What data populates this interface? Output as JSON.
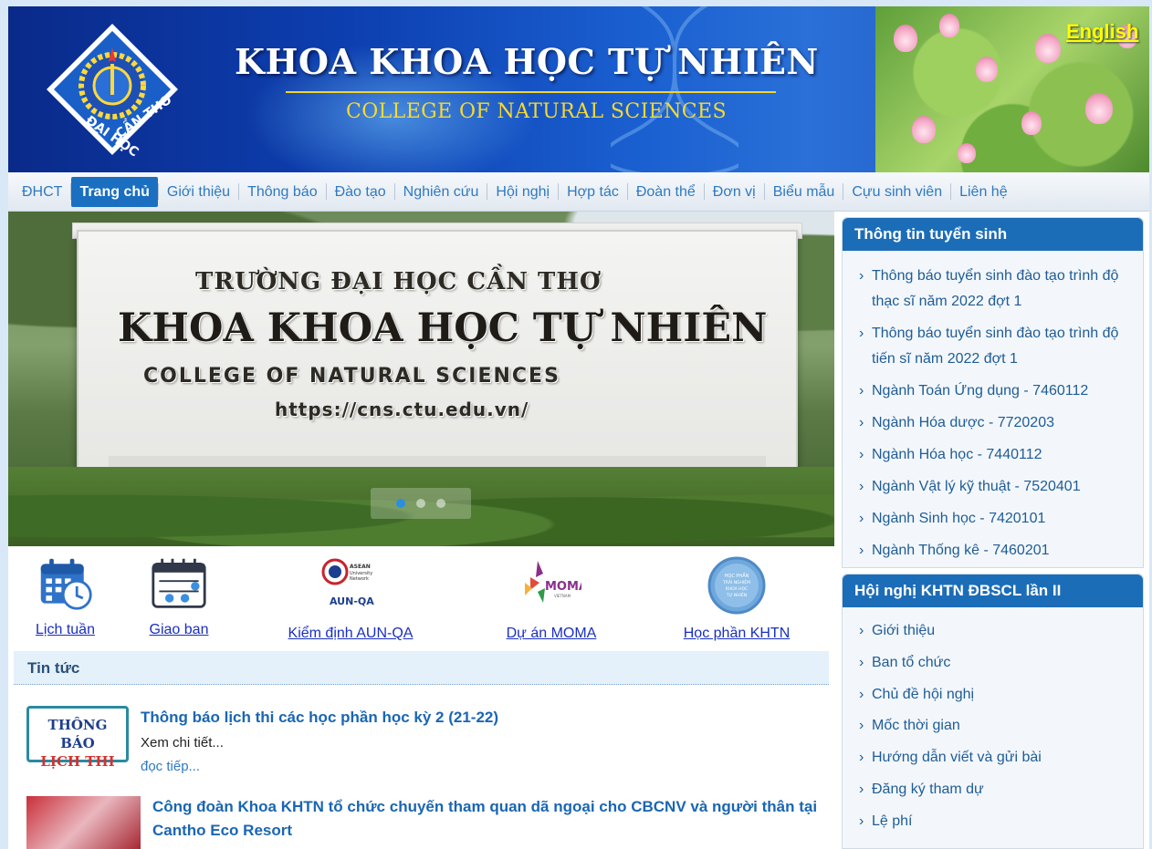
{
  "header": {
    "title": "KHOA KHOA HỌC TỰ NHIÊN",
    "subtitle": "COLLEGE OF NATURAL SCIENCES",
    "logo_icon": "ctu-logo-icon",
    "language_link": "English"
  },
  "nav": {
    "items": [
      {
        "label": "ĐHCT"
      },
      {
        "label": "Trang chủ",
        "active": true
      },
      {
        "label": "Giới thiệu"
      },
      {
        "label": "Thông báo"
      },
      {
        "label": "Đào tạo"
      },
      {
        "label": "Nghiên cứu"
      },
      {
        "label": "Hội nghị"
      },
      {
        "label": "Hợp tác"
      },
      {
        "label": "Đoàn thể"
      },
      {
        "label": "Đơn vị"
      },
      {
        "label": "Biểu mẫu"
      },
      {
        "label": "Cựu sinh viên"
      },
      {
        "label": "Liên hệ"
      }
    ]
  },
  "slider": {
    "sign_line1": "TRƯỜNG ĐẠI HỌC CẦN THƠ",
    "sign_line2": "KHOA KHOA HỌC TỰ NHIÊN",
    "sign_line3": "COLLEGE OF NATURAL SCIENCES",
    "sign_line4": "https://cns.ctu.edu.vn/",
    "active_slide": 1,
    "slide_count": 3
  },
  "quick_links": [
    {
      "label": "Lịch tuần",
      "icon": "calendar-clock-icon"
    },
    {
      "label": "Giao ban",
      "icon": "calendar-check-icon"
    },
    {
      "label": "Kiểm định AUN-QA",
      "icon": "aun-qa-logo-icon"
    },
    {
      "label": "Dự án MOMA",
      "icon": "moma-logo-icon"
    },
    {
      "label": "Học phần KHTN",
      "icon": "hoc-phan-badge-icon"
    }
  ],
  "news": {
    "heading": "Tin tức",
    "items": [
      {
        "title": "Thông báo lịch thi các học phần học kỳ 2 (21-22)",
        "more": "Xem chi tiết...",
        "next": "đọc tiếp...",
        "thumb_line1": "THÔNG BÁO",
        "thumb_line2": "LỊCH THI"
      },
      {
        "title": "Công đoàn Khoa KHTN tổ chức chuyến tham quan dã ngoại cho CBCNV và người thân tại Cantho Eco Resort"
      }
    ]
  },
  "sidebar": {
    "admission": {
      "title": "Thông tin tuyển sinh",
      "items": [
        "Thông báo tuyển sinh đào tạo trình độ thạc sĩ năm 2022 đợt 1",
        "Thông báo tuyển sinh đào tạo trình độ tiến sĩ năm 2022 đợt 1",
        "Ngành Toán Ứng dụng - 7460112",
        "Ngành Hóa dược - 7720203",
        "Ngành Hóa học - 7440112",
        "Ngành Vật lý kỹ thuật - 7520401",
        "Ngành Sinh học - 7420101",
        "Ngành Thống kê - 7460201"
      ]
    },
    "conference": {
      "title": "Hội nghị KHTN ĐBSCL lần II",
      "items": [
        "Giới thiệu",
        "Ban tổ chức",
        "Chủ đề hội nghị",
        "Mốc thời gian",
        "Hướng dẫn viết và gửi bài",
        "Đăng ký tham dự",
        "Lệ phí"
      ]
    }
  },
  "colors": {
    "nav_active": "#1a6fc0",
    "link": "#2f79c2",
    "panel_head": "#1c6db8",
    "english_link": "#ffff00"
  }
}
